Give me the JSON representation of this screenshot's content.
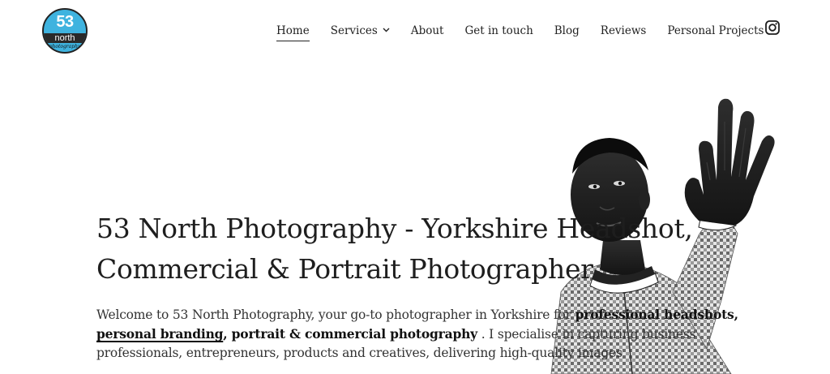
{
  "brand": {
    "number": "53",
    "word": "north",
    "script": "photography",
    "colors": {
      "circle": "#3fb3df",
      "band": "#2a2a2a"
    }
  },
  "nav": {
    "items": [
      {
        "label": "Home",
        "active": true
      },
      {
        "label": "Services",
        "has_dropdown": true
      },
      {
        "label": "About"
      },
      {
        "label": "Get in touch"
      },
      {
        "label": "Blog"
      },
      {
        "label": "Reviews"
      },
      {
        "label": "Personal Projects"
      }
    ],
    "social_icon": "instagram-icon"
  },
  "hero": {
    "title_line1": "53 North Photography - Yorkshire Headshot,",
    "title_line2": "Commercial & Portrait Photographer",
    "photo_icon": "portrait-photo",
    "intro": {
      "part1": "Welcome to 53 North Photography, your go-to photographer in Yorkshire for ",
      "bold1": "professional headshots,",
      "link": "personal branding",
      "bold2": ", portrait & commercial photography",
      "part2": " . I specialise in capturing business professionals, entrepreneurs, products and creatives, delivering high-quality images"
    }
  }
}
